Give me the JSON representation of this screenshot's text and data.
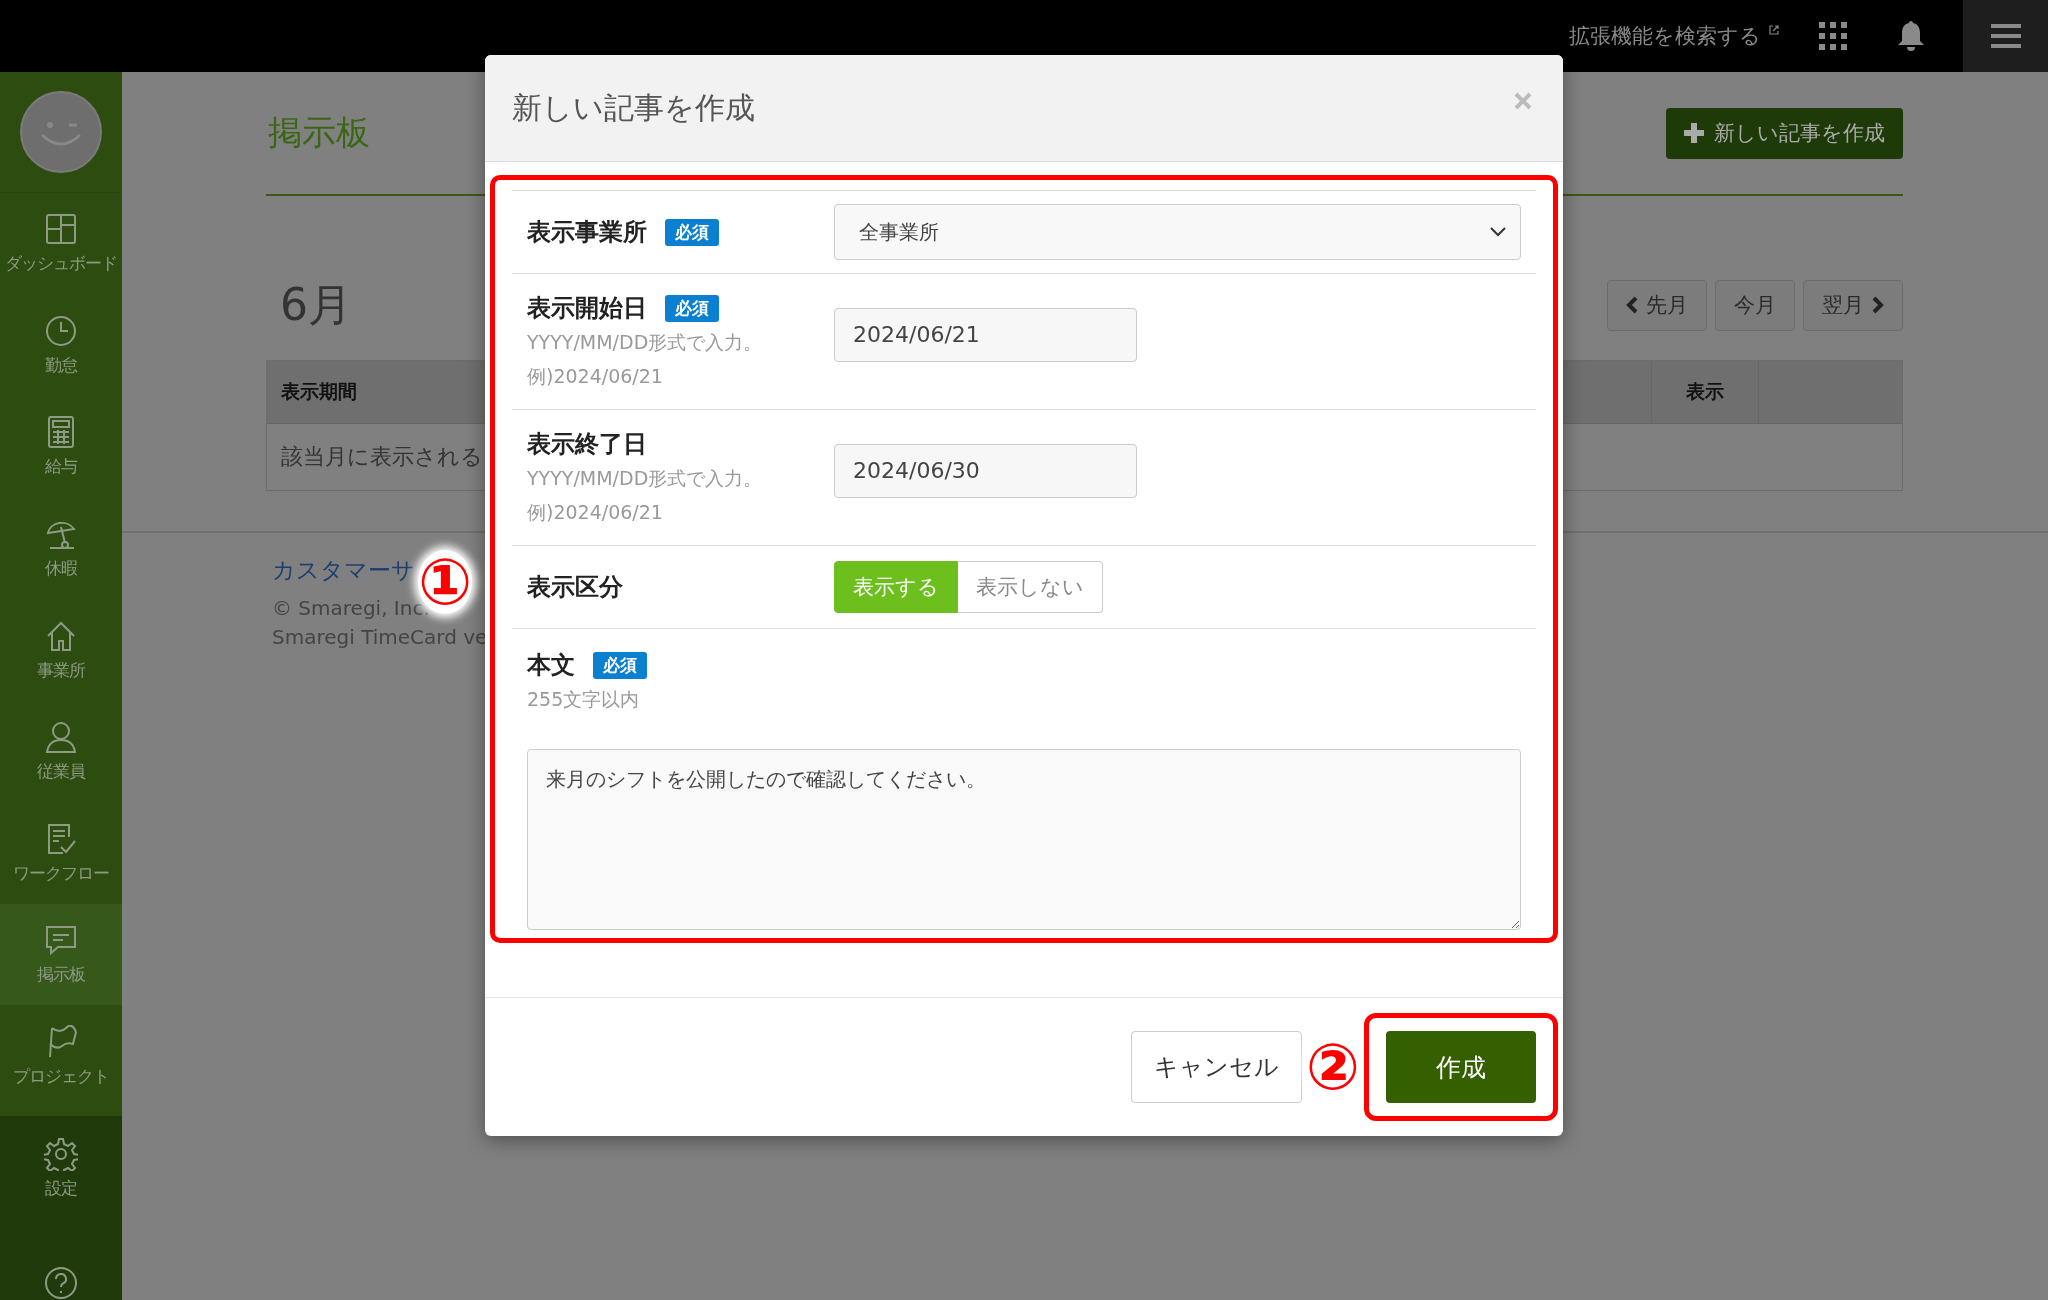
{
  "top_bar": {
    "extension_link": "拡張機能を検索する"
  },
  "sidebar": {
    "items": [
      {
        "label": "ダッシュボード",
        "selected": false
      },
      {
        "label": "勤怠",
        "selected": false
      },
      {
        "label": "給与",
        "selected": false
      },
      {
        "label": "休暇",
        "selected": false
      },
      {
        "label": "事業所",
        "selected": false
      },
      {
        "label": "従業員",
        "selected": false
      },
      {
        "label": "ワークフロー",
        "selected": false
      },
      {
        "label": "掲示板",
        "selected": true
      },
      {
        "label": "プロジェクト",
        "selected": false
      }
    ],
    "bottom_items": [
      {
        "label": "設定",
        "selected": false
      }
    ]
  },
  "page": {
    "title": "掲示板",
    "new_button": "新しい記事を作成",
    "month": "6月",
    "month_nav": [
      {
        "label": "先月",
        "kind": "prev"
      },
      {
        "label": "今月",
        "kind": "current"
      },
      {
        "label": "翌月",
        "kind": "next"
      }
    ],
    "table": {
      "columns": [
        "表示期間",
        "表示"
      ],
      "empty_message": "該当月に表示される"
    },
    "footer": {
      "support_link": "カスタマーサ",
      "copyright": "© Smaregi, Inc.",
      "version": "Smaregi TimeCard ve"
    }
  },
  "modal": {
    "title": "新しい記事を作成",
    "fields": [
      {
        "kind": "select",
        "label": "表示事業所",
        "badge": "必須",
        "value": "全事業所"
      },
      {
        "kind": "date",
        "label": "表示開始日",
        "badge": "必須",
        "hint": [
          "YYYY/MM/DD形式で入力。",
          "例)2024/06/21"
        ],
        "value": "2024/06/21"
      },
      {
        "kind": "date",
        "label": "表示終了日",
        "hint": [
          "YYYY/MM/DD形式で入力。",
          "例)2024/06/21"
        ],
        "value": "2024/06/30"
      },
      {
        "kind": "toggle",
        "label": "表示区分",
        "options": [
          {
            "label": "表示する",
            "selected": true
          },
          {
            "label": "表示しない",
            "selected": false
          }
        ]
      },
      {
        "kind": "textarea",
        "label": "本文",
        "badge": "必須",
        "hint": [
          "255文字以内"
        ],
        "value": "来月のシフトを公開したので確認してください。"
      }
    ],
    "cancel_button": "キャンセル",
    "submit_button": "作成"
  },
  "annotations": [
    "①",
    "②"
  ]
}
